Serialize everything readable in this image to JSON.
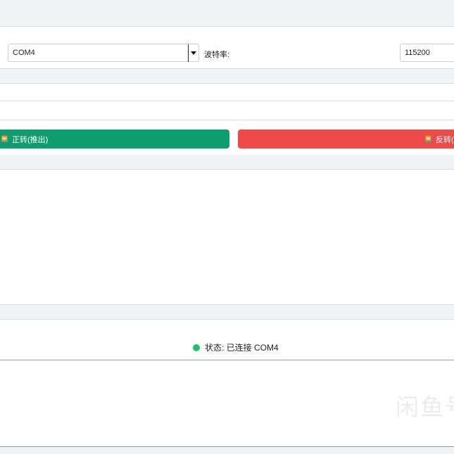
{
  "serial": {
    "port_value": "COM4",
    "baud_label": "波特率:",
    "baud_value": "115200"
  },
  "controls": {
    "forward_label": "正转(推出)",
    "reverse_label": "反转(回",
    "forward_color": "#0f9d6e",
    "reverse_color": "#ef4a4a"
  },
  "status": {
    "text": "状态: 已连接 COM4",
    "indicator_color": "#19c464"
  },
  "watermark": "闲鱼号"
}
